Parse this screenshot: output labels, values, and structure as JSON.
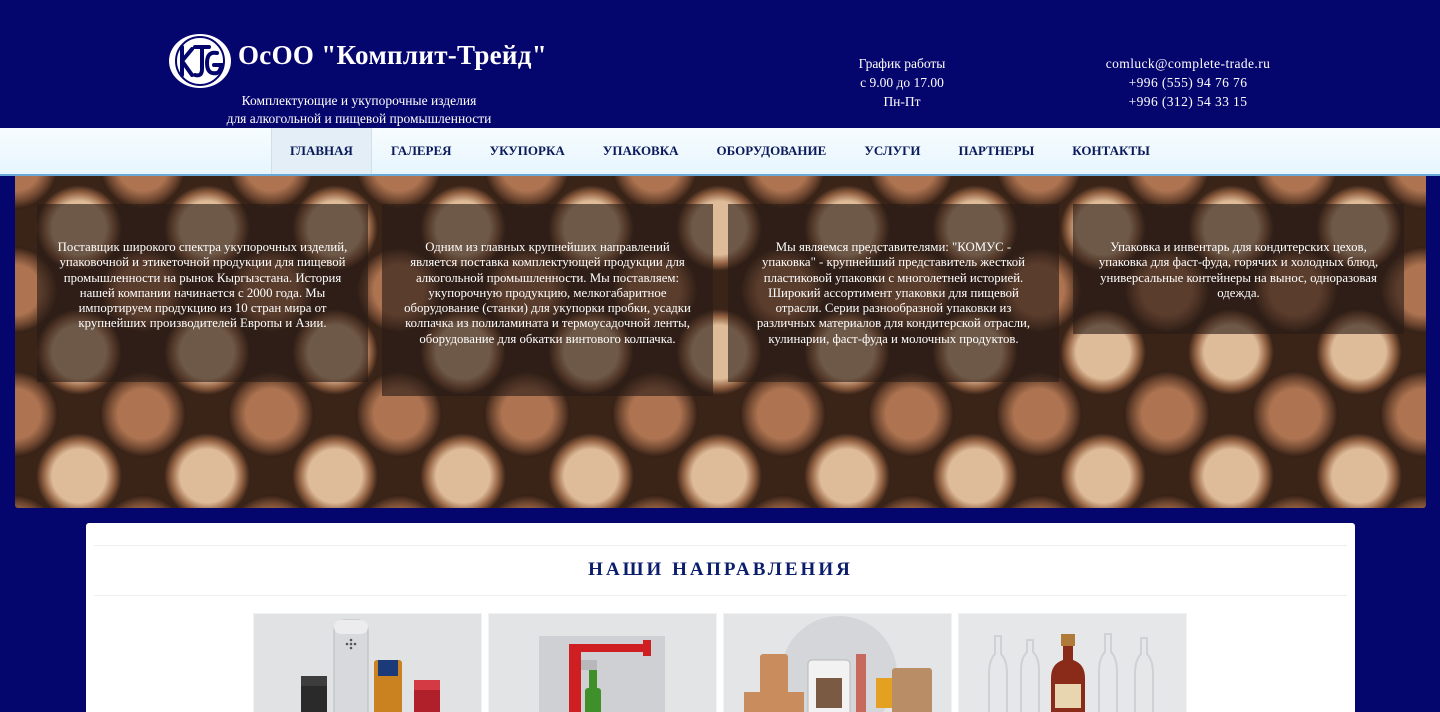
{
  "header": {
    "company_name": "ОсОО \"Комплит-Трейд\"",
    "tagline_line1": "Комплектующие и укупорочные изделия",
    "tagline_line2": "для алкогольной и пищевой промышленности",
    "hours_title": "График работы",
    "hours_time": "с 9.00 до 17.00",
    "hours_days": "Пн-Пт",
    "email": "comluck@complete-trade.ru",
    "phone1": "+996 (555) 94 76 76",
    "phone2": "+996 (312) 54 33 15",
    "logo_icon": "kt-monogram-logo"
  },
  "nav": {
    "items": [
      {
        "label": "ГЛАВНАЯ",
        "active": true
      },
      {
        "label": "ГАЛЕРЕЯ"
      },
      {
        "label": "УКУПОРКА"
      },
      {
        "label": "УПАКОВКА"
      },
      {
        "label": "ОБОРУДОВАНИЕ"
      },
      {
        "label": "УСЛУГИ"
      },
      {
        "label": "ПАРТНЕРЫ"
      },
      {
        "label": "КОНТАКТЫ"
      }
    ]
  },
  "hero": {
    "background": "wine-corks-photo",
    "boxes": [
      "Поставщик широкого спектра укупорочных изделий, упаковочной и этикеточной продукции для пищевой промышленности на рынок Кыргызстана. История нашей компании начинается с 2000 года. Мы импортируем продукцию из 10 стран мира от крупнейших производителей Европы и Азии.",
      "Одним из главных крупнейших направлений является поставка комплектующей продукции для алкогольной промышленности. Мы поставляем: укупорочную продукцию, мелкогабаритное оборудование (станки) для укупорки пробки, усадки колпачка из полиламината и термоусадочной ленты, оборудование для обкатки винтового колпачка.",
      "Мы являемся представителями: \"КОМУС - упаковка\" - крупнейший представитель жесткой пластиковой упаковки с многолетней историей. Широкий ассортимент упаковки для пищевой отрасли. Серии разнообразной упаковки из различных материалов для кондитерской отрасли, кулинарии, фаст-фуда и молочных продуктов.",
      "Упаковка и инвентарь для кондитерских цехов, упаковка для фаст-фуда, горячих и холодных блюд, универсальные контейнеры на вынос, одноразовая одежда."
    ]
  },
  "section": {
    "title": "НАШИ НАПРАВЛЕНИЯ",
    "cards": [
      {
        "image": "bottle-caps-image"
      },
      {
        "image": "corking-machine-image"
      },
      {
        "image": "food-packaging-image"
      },
      {
        "image": "glass-bottles-image"
      }
    ]
  },
  "colors": {
    "background": "#05056e",
    "nav_text": "#0a1a5a",
    "title": "#0b1e6b"
  }
}
